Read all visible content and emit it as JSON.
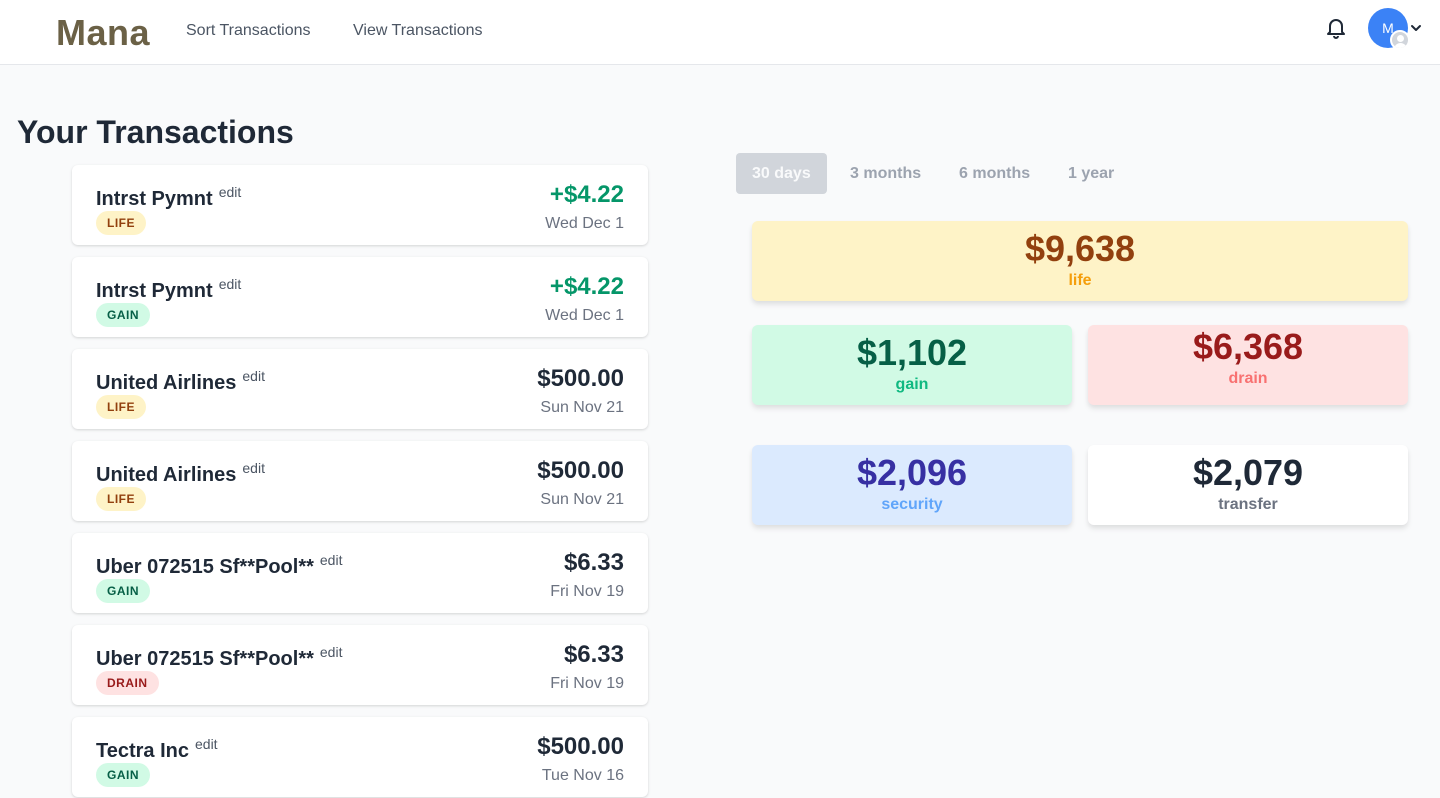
{
  "nav": {
    "logo": "Mana",
    "links": [
      "Sort Transactions",
      "View Transactions"
    ],
    "avatar_initial": "M",
    "icons": {
      "notifications": "bell-icon",
      "account_menu": "chevron-down-icon"
    }
  },
  "page_title": "Your Transactions",
  "transactions": [
    {
      "name": "Intrst Pymnt",
      "edit": "edit",
      "category": "LIFE",
      "amount": "+$4.22",
      "date": "Wed Dec 1"
    },
    {
      "name": "Intrst Pymnt",
      "edit": "edit",
      "category": "GAIN",
      "amount": "+$4.22",
      "date": "Wed Dec 1"
    },
    {
      "name": "United Airlines",
      "edit": "edit",
      "category": "LIFE",
      "amount": "$500.00",
      "date": "Sun Nov 21"
    },
    {
      "name": "United Airlines",
      "edit": "edit",
      "category": "LIFE",
      "amount": "$500.00",
      "date": "Sun Nov 21"
    },
    {
      "name": "Uber 072515 Sf**Pool**",
      "edit": "edit",
      "category": "GAIN",
      "amount": "$6.33",
      "date": "Fri Nov 19"
    },
    {
      "name": "Uber 072515 Sf**Pool**",
      "edit": "edit",
      "category": "DRAIN",
      "amount": "$6.33",
      "date": "Fri Nov 19"
    },
    {
      "name": "Tectra Inc",
      "edit": "edit",
      "category": "GAIN",
      "amount": "$500.00",
      "date": "Tue Nov 16"
    }
  ],
  "range_tabs": {
    "options": [
      "30 days",
      "3 months",
      "6 months",
      "1 year"
    ],
    "selected": "30 days"
  },
  "summary": {
    "life": {
      "value": "$9,638",
      "label": "life"
    },
    "gain": {
      "value": "$1,102",
      "label": "gain"
    },
    "drain": {
      "value": "$6,368",
      "label": "drain"
    },
    "security": {
      "value": "$2,096",
      "label": "security"
    },
    "transfer": {
      "value": "$2,079",
      "label": "transfer"
    }
  },
  "colors": {
    "logo": "#6b6146",
    "positive_amount": "#059669",
    "life": "#fef3c7",
    "gain": "#d1fae5",
    "drain": "#fee2e2",
    "security": "#dbeafe",
    "avatar": "#3b82f6"
  }
}
